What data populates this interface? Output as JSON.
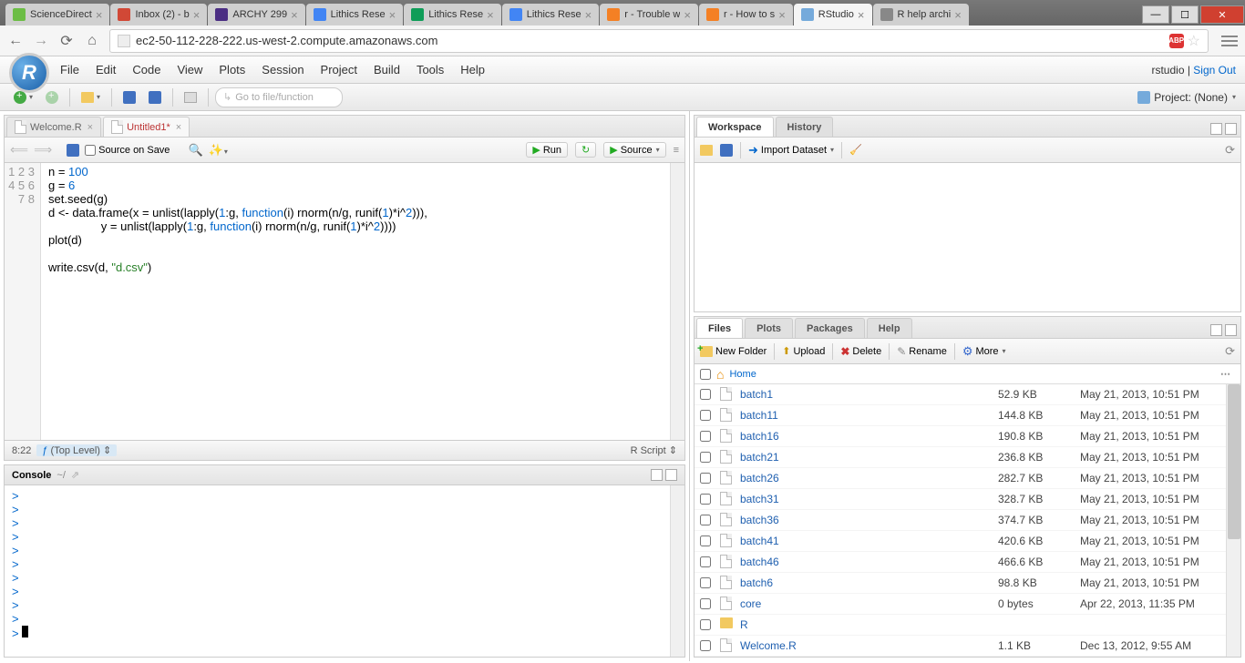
{
  "chrome": {
    "tabs": [
      {
        "label": "ScienceDirect",
        "color": "#6cbd45"
      },
      {
        "label": "Inbox (2) - b",
        "color": "#d14836"
      },
      {
        "label": "ARCHY 299",
        "color": "#4b2e83"
      },
      {
        "label": "Lithics Rese",
        "color": "#4285f4"
      },
      {
        "label": "Lithics Rese",
        "color": "#0f9d58"
      },
      {
        "label": "Lithics Rese",
        "color": "#4285f4"
      },
      {
        "label": "r - Trouble w",
        "color": "#f48024"
      },
      {
        "label": "r - How to s",
        "color": "#f48024"
      },
      {
        "label": "RStudio",
        "color": "#75aadb",
        "active": true
      },
      {
        "label": "R help archi",
        "color": "#888"
      }
    ],
    "url": "ec2-50-112-228-222.us-west-2.compute.amazonaws.com"
  },
  "rs": {
    "menu": [
      "File",
      "Edit",
      "Code",
      "View",
      "Plots",
      "Session",
      "Project",
      "Build",
      "Tools",
      "Help"
    ],
    "brand": "rstudio",
    "signout": "Sign Out",
    "goto_ph": "Go to file/function",
    "project_label": "Project: (None)"
  },
  "editor": {
    "tabs": [
      {
        "name": "Welcome.R"
      },
      {
        "name": "Untitled1*",
        "active": true
      }
    ],
    "source_on_save": "Source on Save",
    "run": "Run",
    "source": "Source",
    "status_pos": "8:22",
    "status_scope": "(Top Level)",
    "status_type": "R Script",
    "code_lines": [
      "n = <100>",
      "g = <6>",
      "set.seed(g)",
      "d <- data.frame(x = unlist(lapply(<1>:g, [function](i) rnorm(n/g, runif(<1>)*i^<2>))),",
      "                y = unlist(lapply(<1>:g, [function](i) rnorm(n/g, runif(<1>)*i^<2>))))",
      "plot(d)",
      "",
      "write.csv(d, {\"d.csv\"})"
    ]
  },
  "console": {
    "title": "Console",
    "path": "~/",
    "prompts": 10
  },
  "workspace": {
    "tabs": [
      "Workspace",
      "History"
    ],
    "import": "Import Dataset"
  },
  "files_pane": {
    "tabs": [
      "Files",
      "Plots",
      "Packages",
      "Help"
    ],
    "new_folder": "New Folder",
    "upload": "Upload",
    "delete": "Delete",
    "rename": "Rename",
    "more": "More",
    "home": "Home",
    "rows": [
      {
        "name": "batch1",
        "size": "52.9 KB",
        "date": "May 21, 2013, 10:51 PM",
        "ico": "doc"
      },
      {
        "name": "batch11",
        "size": "144.8 KB",
        "date": "May 21, 2013, 10:51 PM",
        "ico": "doc"
      },
      {
        "name": "batch16",
        "size": "190.8 KB",
        "date": "May 21, 2013, 10:51 PM",
        "ico": "doc"
      },
      {
        "name": "batch21",
        "size": "236.8 KB",
        "date": "May 21, 2013, 10:51 PM",
        "ico": "doc"
      },
      {
        "name": "batch26",
        "size": "282.7 KB",
        "date": "May 21, 2013, 10:51 PM",
        "ico": "doc"
      },
      {
        "name": "batch31",
        "size": "328.7 KB",
        "date": "May 21, 2013, 10:51 PM",
        "ico": "doc"
      },
      {
        "name": "batch36",
        "size": "374.7 KB",
        "date": "May 21, 2013, 10:51 PM",
        "ico": "doc"
      },
      {
        "name": "batch41",
        "size": "420.6 KB",
        "date": "May 21, 2013, 10:51 PM",
        "ico": "doc"
      },
      {
        "name": "batch46",
        "size": "466.6 KB",
        "date": "May 21, 2013, 10:51 PM",
        "ico": "doc"
      },
      {
        "name": "batch6",
        "size": "98.8 KB",
        "date": "May 21, 2013, 10:51 PM",
        "ico": "doc"
      },
      {
        "name": "core",
        "size": "0 bytes",
        "date": "Apr 22, 2013, 11:35 PM",
        "ico": "doc"
      },
      {
        "name": "R",
        "size": "",
        "date": "",
        "ico": "folder"
      },
      {
        "name": "Welcome.R",
        "size": "1.1 KB",
        "date": "Dec 13, 2012, 9:55 AM",
        "ico": "rdoc"
      }
    ]
  }
}
